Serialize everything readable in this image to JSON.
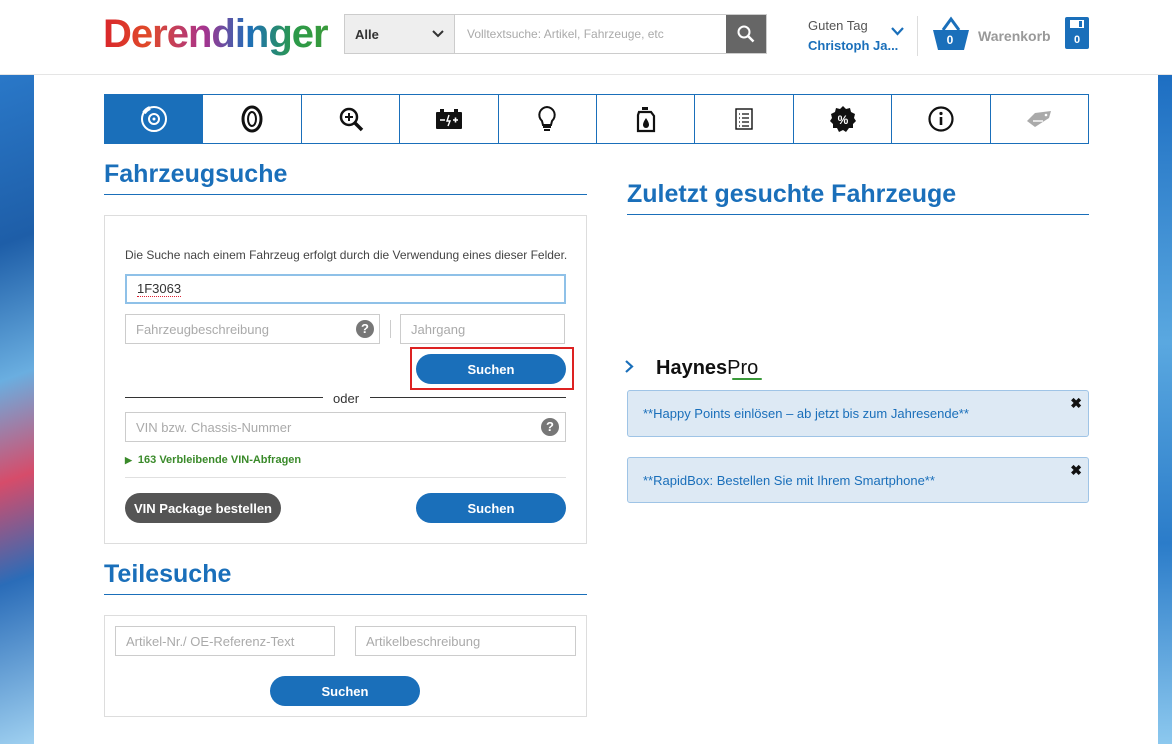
{
  "header": {
    "logo": "Derendinger",
    "search_category": "Alle",
    "search_placeholder": "Volltextsuche: Artikel, Fahrzeuge, etc",
    "greeting": "Guten Tag",
    "username": "Christoph Ja...",
    "cart_count": "0",
    "cart_label": "Warenkorb",
    "saved_count": "0"
  },
  "tabs": [
    {
      "icon": "brake-disc-icon",
      "active": true
    },
    {
      "icon": "tire-icon",
      "active": false
    },
    {
      "icon": "zoom-search-icon",
      "active": false
    },
    {
      "icon": "battery-icon",
      "active": false
    },
    {
      "icon": "bulb-icon",
      "active": false
    },
    {
      "icon": "oil-can-icon",
      "active": false
    },
    {
      "icon": "document-list-icon",
      "active": false
    },
    {
      "icon": "discount-badge-icon",
      "active": false
    },
    {
      "icon": "info-icon",
      "active": false
    },
    {
      "icon": "tag-icon",
      "active": false
    }
  ],
  "vehicle_search": {
    "title": "Fahrzeugsuche",
    "hint": "Die Suche nach einem Fahrzeug erfolgt durch die Verwendung eines dieser Felder.",
    "code_value": "1F3063",
    "description_placeholder": "Fahrzeugbeschreibung",
    "year_placeholder": "Jahrgang",
    "search_label": "Suchen",
    "or_label": "oder",
    "vin_placeholder": "VIN bzw. Chassis-Nummer",
    "vin_remaining": "163 Verbleibende VIN-Abfragen",
    "vin_package_label": "VIN Package bestellen",
    "vin_search_label": "Suchen"
  },
  "parts_search": {
    "title": "Teilesuche",
    "article_placeholder": "Artikel-Nr./ OE-Referenz-Text",
    "description_placeholder": "Artikelbeschreibung",
    "search_label": "Suchen"
  },
  "recent": {
    "title": "Zuletzt gesuchte Fahrzeuge",
    "haynes_main": "Haynes",
    "haynes_pro": "Pro"
  },
  "notices": [
    {
      "text": "**Happy Points einlösen – ab jetzt bis zum Jahresende**"
    },
    {
      "text": "**RapidBox: Bestellen Sie mit Ihrem Smartphone**"
    }
  ],
  "colors": {
    "accent": "#1a6fba",
    "highlight": "#dd2222",
    "vin_green": "#3a8a2a"
  }
}
